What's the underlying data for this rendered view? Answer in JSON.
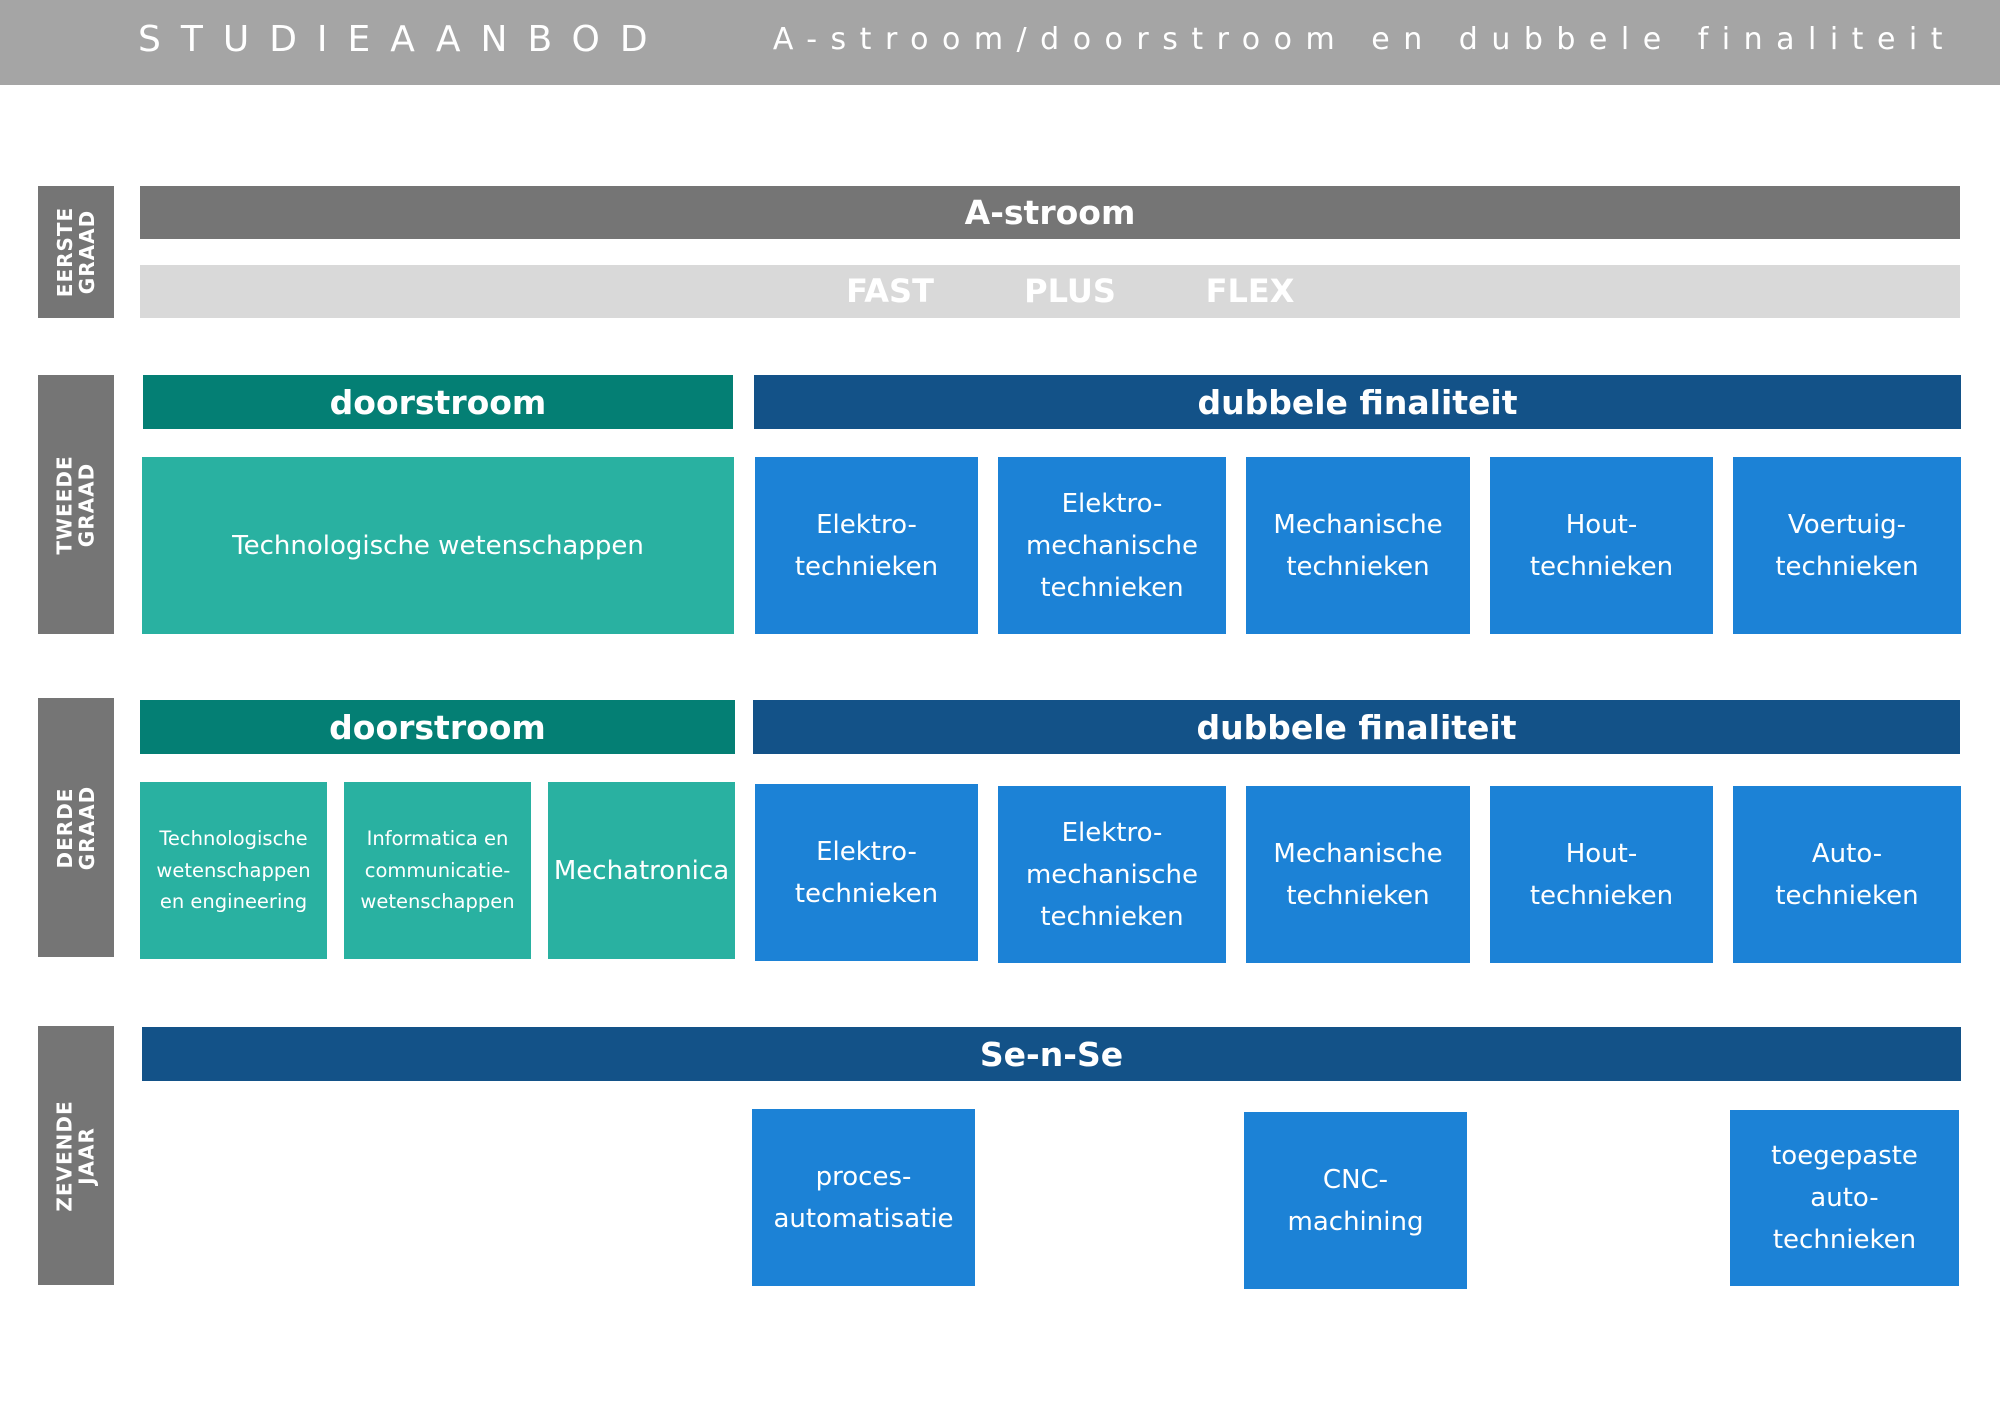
{
  "header": {
    "title": "STUDIEAANBOD",
    "subtitle": "A-stroom/doorstroom en dubbele finaliteit"
  },
  "side_labels": {
    "eerste": "EERSTE\nGRAAD",
    "tweede": "TWEEDE\nGRAAD",
    "derde": "DERDE\nGRAAD",
    "zevende": "ZEVENDE\nJAAR"
  },
  "eerste_graad": {
    "stream": "A-stroom",
    "options": [
      "FAST",
      "PLUS",
      "FLEX"
    ]
  },
  "tweede_graad": {
    "doorstroom_label": "doorstroom",
    "dubbele_label": "dubbele finaliteit",
    "doorstroom_boxes": [
      "Technologische wetenschappen"
    ],
    "dubbele_boxes": [
      "Elektro-\ntechnieken",
      "Elektro-\nmechanische\ntechnieken",
      "Mechanische\ntechnieken",
      "Hout-\ntechnieken",
      "Voertuig-\ntechnieken"
    ]
  },
  "derde_graad": {
    "doorstroom_label": "doorstroom",
    "dubbele_label": "dubbele finaliteit",
    "doorstroom_boxes": [
      "Technologische\nwetenschappen\nen engineering",
      "Informatica en\ncommunicatie-\nwetenschappen",
      "Mechatronica"
    ],
    "dubbele_boxes": [
      "Elektro-\ntechnieken",
      "Elektro-\nmechanische\ntechnieken",
      "Mechanische\ntechnieken",
      "Hout-\ntechnieken",
      "Auto-\ntechnieken"
    ]
  },
  "zevende_jaar": {
    "label": "Se-n-Se",
    "boxes": [
      "proces-\nautomatisatie",
      "CNC-\nmachining",
      "toegepaste\nauto-\ntechnieken"
    ]
  },
  "colors": {
    "header": "#a5a5a5",
    "side": "#757575",
    "teal_dark": "#047f74",
    "teal": "#29b1a1",
    "navy": "#135288",
    "blue": "#1c82d6",
    "light_gray": "#d9d9d9"
  }
}
